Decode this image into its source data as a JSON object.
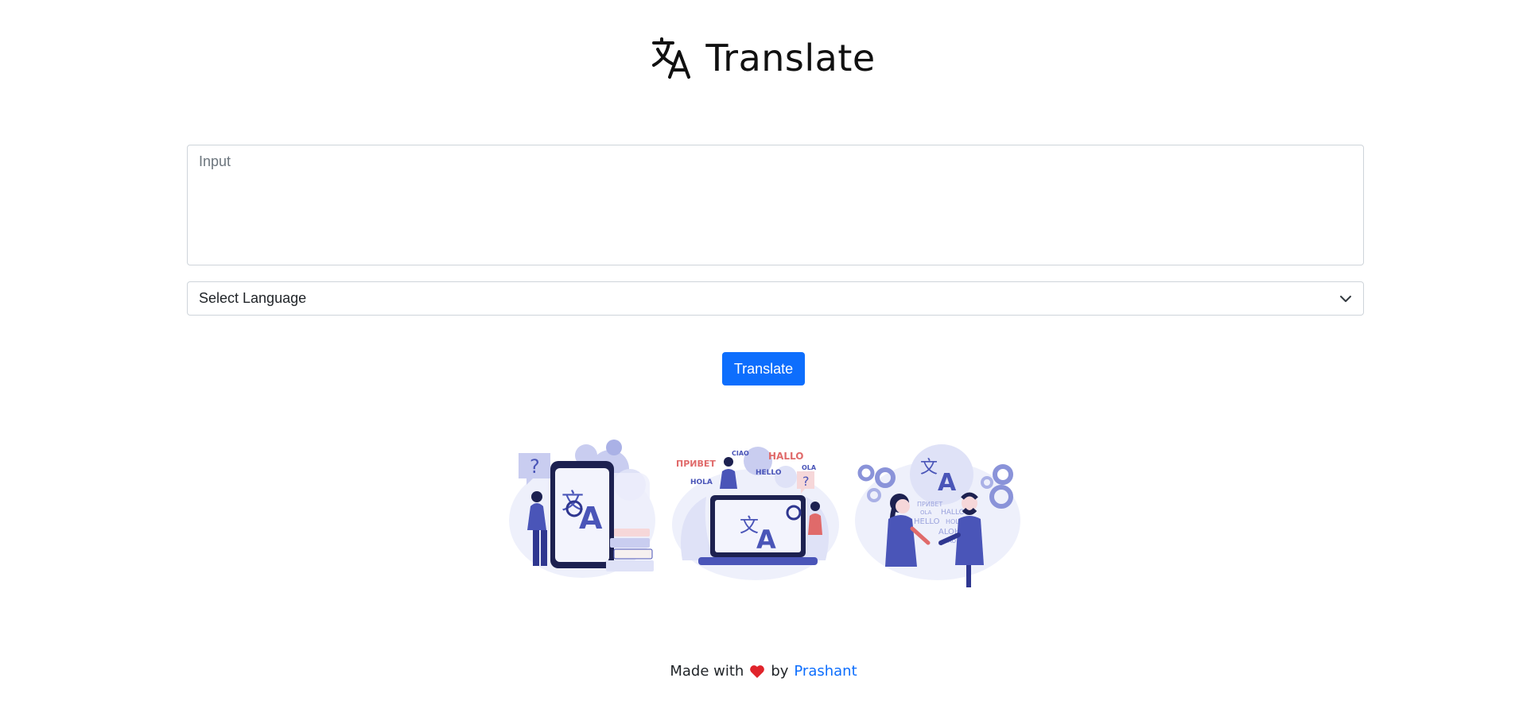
{
  "header": {
    "title": "Translate",
    "logo_icon": "translate-icon"
  },
  "input": {
    "placeholder": "Input",
    "value": ""
  },
  "language_select": {
    "selected": "Select Language",
    "icon": "chevron-down-icon"
  },
  "actions": {
    "translate_label": "Translate"
  },
  "illustrations": {
    "panel_1_icon": "translate-phone-illustration",
    "panel_2_icon": "translate-laptop-illustration",
    "panel_3_icon": "translate-conversation-illustration"
  },
  "footer": {
    "made_with": "Made with",
    "heart_icon": "heart-icon",
    "by": "by",
    "author": "Prashant"
  },
  "colors": {
    "primary": "#0d6efd",
    "heart": "#e0242b",
    "illustration_main": "#4a55b8",
    "illustration_soft": "#c9cdf0"
  }
}
